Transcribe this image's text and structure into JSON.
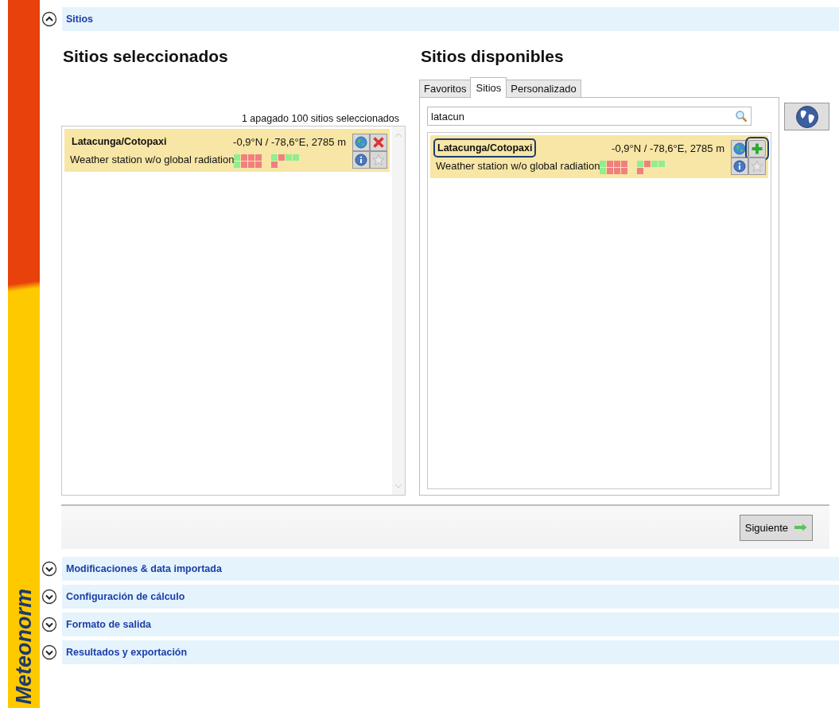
{
  "brand": "Meteonorm",
  "sections_top": {
    "title": "Sitios",
    "expanded": true
  },
  "selected_panel": {
    "heading": "Sitios seleccionados",
    "count_text": "1 apagado 100 sitios seleccionados",
    "items": [
      {
        "name": "Latacunga/Cotopaxi",
        "coords": "-0,9°N / -78,6°E, 2785 m",
        "description": "Weather station w/o global radiation",
        "highlighted": false,
        "kind": "remove",
        "add_highlighted": false,
        "grids": [
          [
            [
              {
                "color": "#90ee90"
              },
              {
                "color": "#f08080"
              },
              {
                "color": "#f08080"
              },
              {
                "color": "#f08080"
              }
            ],
            [
              {
                "color": "#90ee90"
              },
              {
                "color": "#f08080"
              },
              {
                "color": "#f08080"
              },
              {
                "color": "#f08080"
              }
            ]
          ],
          [
            [
              {
                "color": "#90ee90"
              },
              {
                "color": "#f08080"
              },
              {
                "color": "#90ee90"
              },
              {
                "color": "#90ee90"
              }
            ],
            [
              {
                "color": "#f08080"
              }
            ]
          ]
        ]
      }
    ]
  },
  "available_panel": {
    "heading": "Sitios disponibles",
    "tabs": [
      {
        "label": "Favoritos",
        "selected": false
      },
      {
        "label": "Sitios",
        "selected": true
      },
      {
        "label": "Personalizado",
        "selected": false
      }
    ],
    "search": {
      "value": "latacun"
    },
    "items": [
      {
        "name": "Latacunga/Cotopaxi",
        "coords": "-0,9°N / -78,6°E, 2785 m",
        "description": "Weather station w/o global radiation",
        "highlighted": true,
        "kind": "add",
        "add_highlighted": true,
        "grids": [
          [
            [
              {
                "color": "#90ee90"
              },
              {
                "color": "#f08080"
              },
              {
                "color": "#f08080"
              },
              {
                "color": "#f08080"
              }
            ],
            [
              {
                "color": "#90ee90"
              },
              {
                "color": "#f08080"
              },
              {
                "color": "#f08080"
              },
              {
                "color": "#f08080"
              }
            ]
          ],
          [
            [
              {
                "color": "#90ee90"
              },
              {
                "color": "#f08080"
              },
              {
                "color": "#90ee90"
              },
              {
                "color": "#90ee90"
              }
            ],
            [
              {
                "color": "#f08080"
              }
            ]
          ]
        ]
      }
    ]
  },
  "next_button": {
    "label": "Siguiente"
  },
  "sections": [
    {
      "title": "Modificaciones & data importada",
      "expanded": false
    },
    {
      "title": "Configuración de cálculo",
      "expanded": false
    },
    {
      "title": "Formato de salida",
      "expanded": false
    },
    {
      "title": "Resultados y exportación",
      "expanded": false
    }
  ]
}
